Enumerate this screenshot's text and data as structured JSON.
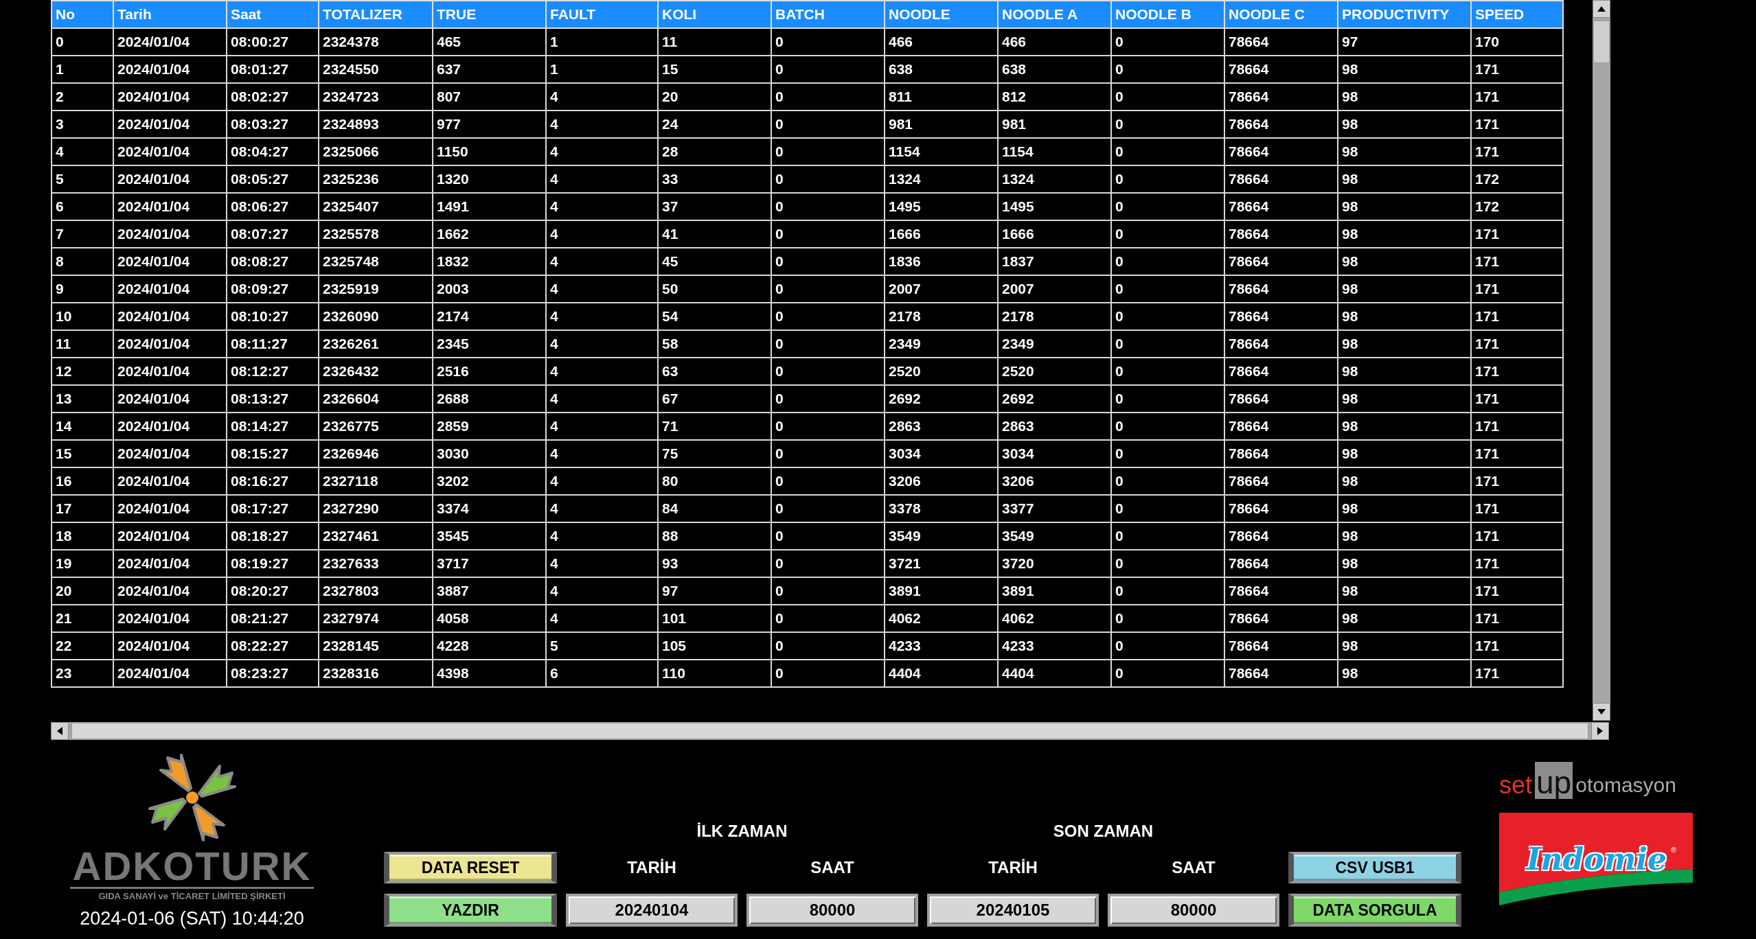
{
  "table": {
    "columns": [
      "No",
      "Tarih",
      "Saat",
      "TOTALIZER",
      "TRUE",
      "FAULT",
      "KOLI",
      "BATCH",
      "NOODLE",
      "NOODLE A",
      "NOODLE B",
      "NOODLE C",
      "PRODUCTIVITY",
      "SPEED"
    ],
    "rows": [
      [
        "0",
        "2024/01/04",
        "08:00:27",
        "2324378",
        "465",
        "1",
        "11",
        "0",
        "466",
        "466",
        "0",
        "78664",
        "97",
        "170"
      ],
      [
        "1",
        "2024/01/04",
        "08:01:27",
        "2324550",
        "637",
        "1",
        "15",
        "0",
        "638",
        "638",
        "0",
        "78664",
        "98",
        "171"
      ],
      [
        "2",
        "2024/01/04",
        "08:02:27",
        "2324723",
        "807",
        "4",
        "20",
        "0",
        "811",
        "812",
        "0",
        "78664",
        "98",
        "171"
      ],
      [
        "3",
        "2024/01/04",
        "08:03:27",
        "2324893",
        "977",
        "4",
        "24",
        "0",
        "981",
        "981",
        "0",
        "78664",
        "98",
        "171"
      ],
      [
        "4",
        "2024/01/04",
        "08:04:27",
        "2325066",
        "1150",
        "4",
        "28",
        "0",
        "1154",
        "1154",
        "0",
        "78664",
        "98",
        "171"
      ],
      [
        "5",
        "2024/01/04",
        "08:05:27",
        "2325236",
        "1320",
        "4",
        "33",
        "0",
        "1324",
        "1324",
        "0",
        "78664",
        "98",
        "172"
      ],
      [
        "6",
        "2024/01/04",
        "08:06:27",
        "2325407",
        "1491",
        "4",
        "37",
        "0",
        "1495",
        "1495",
        "0",
        "78664",
        "98",
        "172"
      ],
      [
        "7",
        "2024/01/04",
        "08:07:27",
        "2325578",
        "1662",
        "4",
        "41",
        "0",
        "1666",
        "1666",
        "0",
        "78664",
        "98",
        "171"
      ],
      [
        "8",
        "2024/01/04",
        "08:08:27",
        "2325748",
        "1832",
        "4",
        "45",
        "0",
        "1836",
        "1837",
        "0",
        "78664",
        "98",
        "171"
      ],
      [
        "9",
        "2024/01/04",
        "08:09:27",
        "2325919",
        "2003",
        "4",
        "50",
        "0",
        "2007",
        "2007",
        "0",
        "78664",
        "98",
        "171"
      ],
      [
        "10",
        "2024/01/04",
        "08:10:27",
        "2326090",
        "2174",
        "4",
        "54",
        "0",
        "2178",
        "2178",
        "0",
        "78664",
        "98",
        "171"
      ],
      [
        "11",
        "2024/01/04",
        "08:11:27",
        "2326261",
        "2345",
        "4",
        "58",
        "0",
        "2349",
        "2349",
        "0",
        "78664",
        "98",
        "171"
      ],
      [
        "12",
        "2024/01/04",
        "08:12:27",
        "2326432",
        "2516",
        "4",
        "63",
        "0",
        "2520",
        "2520",
        "0",
        "78664",
        "98",
        "171"
      ],
      [
        "13",
        "2024/01/04",
        "08:13:27",
        "2326604",
        "2688",
        "4",
        "67",
        "0",
        "2692",
        "2692",
        "0",
        "78664",
        "98",
        "171"
      ],
      [
        "14",
        "2024/01/04",
        "08:14:27",
        "2326775",
        "2859",
        "4",
        "71",
        "0",
        "2863",
        "2863",
        "0",
        "78664",
        "98",
        "171"
      ],
      [
        "15",
        "2024/01/04",
        "08:15:27",
        "2326946",
        "3030",
        "4",
        "75",
        "0",
        "3034",
        "3034",
        "0",
        "78664",
        "98",
        "171"
      ],
      [
        "16",
        "2024/01/04",
        "08:16:27",
        "2327118",
        "3202",
        "4",
        "80",
        "0",
        "3206",
        "3206",
        "0",
        "78664",
        "98",
        "171"
      ],
      [
        "17",
        "2024/01/04",
        "08:17:27",
        "2327290",
        "3374",
        "4",
        "84",
        "0",
        "3378",
        "3377",
        "0",
        "78664",
        "98",
        "171"
      ],
      [
        "18",
        "2024/01/04",
        "08:18:27",
        "2327461",
        "3545",
        "4",
        "88",
        "0",
        "3549",
        "3549",
        "0",
        "78664",
        "98",
        "171"
      ],
      [
        "19",
        "2024/01/04",
        "08:19:27",
        "2327633",
        "3717",
        "4",
        "93",
        "0",
        "3721",
        "3720",
        "0",
        "78664",
        "98",
        "171"
      ],
      [
        "20",
        "2024/01/04",
        "08:20:27",
        "2327803",
        "3887",
        "4",
        "97",
        "0",
        "3891",
        "3891",
        "0",
        "78664",
        "98",
        "171"
      ],
      [
        "21",
        "2024/01/04",
        "08:21:27",
        "2327974",
        "4058",
        "4",
        "101",
        "0",
        "4062",
        "4062",
        "0",
        "78664",
        "98",
        "171"
      ],
      [
        "22",
        "2024/01/04",
        "08:22:27",
        "2328145",
        "4228",
        "5",
        "105",
        "0",
        "4233",
        "4233",
        "0",
        "78664",
        "98",
        "171"
      ],
      [
        "23",
        "2024/01/04",
        "08:23:27",
        "2328316",
        "4398",
        "6",
        "110",
        "0",
        "4404",
        "4404",
        "0",
        "78664",
        "98",
        "171"
      ]
    ]
  },
  "company_logo": {
    "name": "ADKOTURK",
    "subtitle": "GIDA SANAYİ ve TİCARET LİMİTED ŞİRKETİ"
  },
  "clock": "2024-01-06 (SAT) 10:44:20",
  "left_buttons": [
    {
      "label": "DATA RESET",
      "color": "#ece591"
    },
    {
      "label": "YAZDIR",
      "color": "#8fe08a"
    }
  ],
  "ranges": [
    {
      "title": "İLK ZAMAN",
      "date_label": "TARİH",
      "time_label": "SAAT",
      "date": "20240104",
      "time": "80000"
    },
    {
      "title": "SON ZAMAN",
      "date_label": "TARİH",
      "time_label": "SAAT",
      "date": "20240105",
      "time": "80000"
    }
  ],
  "right_buttons": [
    {
      "label": "CSV USB1",
      "color": "#8ed2e6"
    },
    {
      "label": "DATA SORGULA",
      "color": "#7fd86a"
    }
  ],
  "partner_logo": {
    "prefix": "set",
    "box": "up",
    "suffix": "otomasyon"
  },
  "product_logo": {
    "text": "Indomie",
    "mark": "®"
  }
}
